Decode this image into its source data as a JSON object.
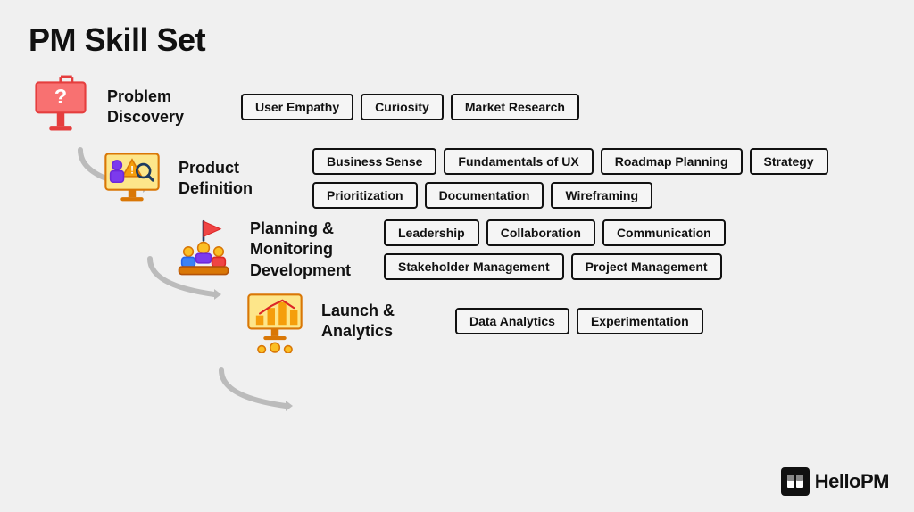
{
  "page": {
    "title": "PM Skill Set"
  },
  "logo": {
    "text": "HelloPM",
    "icon": "🏠"
  },
  "rows": [
    {
      "id": "problem-discovery",
      "label": "Problem\nDiscovery",
      "indent": 0,
      "tags": [
        "User Empathy",
        "Curiosity",
        "Market Research"
      ]
    },
    {
      "id": "product-definition",
      "label": "Product\nDefinition",
      "indent": 1,
      "tags": [
        "Business Sense",
        "Fundamentals of UX",
        "Roadmap Planning",
        "Strategy",
        "Prioritization",
        "Documentation",
        "Wireframing"
      ]
    },
    {
      "id": "planning-monitoring",
      "label": "Planning &\nMonitoring\nDevelopment",
      "indent": 2,
      "tags": [
        "Leadership",
        "Collaboration",
        "Communication",
        "Stakeholder Management",
        "Project Management"
      ]
    },
    {
      "id": "launch-analytics",
      "label": "Launch &\nAnalytics",
      "indent": 3,
      "tags": [
        "Data Analytics",
        "Experimentation"
      ]
    }
  ]
}
